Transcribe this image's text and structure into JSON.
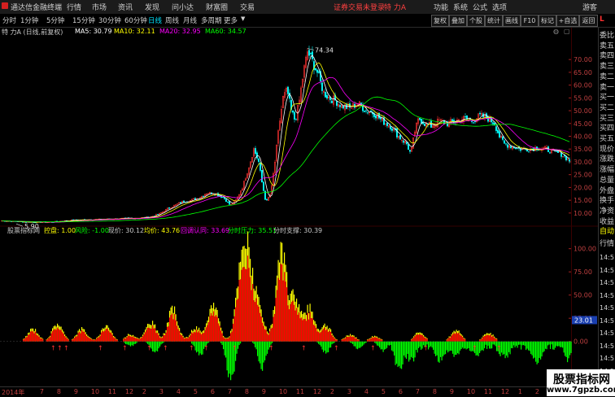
{
  "menu": {
    "app_name": "通达信金融终端",
    "items": [
      "行情",
      "市场",
      "资讯",
      "发现",
      "问小达",
      "财富圈",
      "交易"
    ],
    "notice": "证券交易未登录",
    "stock_name": "特 力A",
    "right_items": [
      "功能",
      "系统",
      "公式",
      "选项",
      "游客"
    ]
  },
  "periods": {
    "items": [
      "分时",
      "1分钟",
      "5分钟",
      "15分钟",
      "30分钟",
      "60分钟",
      "日线",
      "周线",
      "月线",
      "多周期",
      "更多"
    ],
    "active": "日线"
  },
  "toolbar": [
    "复权",
    "叠加",
    "个股",
    "统计",
    "画线",
    "F10",
    "标记",
    "+自选",
    "返回"
  ],
  "main_info": {
    "title": "特 力A (日线,前复权)",
    "ma5": "MA5: 30.79",
    "ma10": "MA10: 32.11",
    "ma20": "MA20: 32.95",
    "ma60": "MA60: 34.57"
  },
  "colors": {
    "rise": "#ff3232",
    "fall": "#00ffff",
    "ma5": "#ffffff",
    "ma10": "#ffff00",
    "ma20": "#ff00ff",
    "ma60": "#00ff00",
    "ind_red": "#ff0000",
    "ind_yellow": "#ffff00",
    "ind_green": "#00ff00"
  },
  "price_labels": {
    "high": "74.34",
    "low": "5.90"
  },
  "chart_data": [
    {
      "type": "candlestick",
      "title": "特 力A (日线,前复权)",
      "y_ticks": [
        70,
        65,
        60,
        55,
        50,
        45,
        40,
        35,
        30,
        25,
        20,
        15,
        10
      ],
      "ylim": [
        5.5,
        78
      ],
      "grid": false,
      "series": [
        {
          "name": "MA5",
          "value": 30.79
        },
        {
          "name": "MA10",
          "value": 32.11
        },
        {
          "name": "MA20",
          "value": 32.95
        },
        {
          "name": "MA60",
          "value": 34.57
        }
      ],
      "close_path": [
        [
          0,
          7
        ],
        [
          30,
          6.5
        ],
        [
          60,
          6.4
        ],
        [
          90,
          7.2
        ],
        [
          120,
          7.5
        ],
        [
          150,
          7.8
        ],
        [
          170,
          8.0
        ],
        [
          185,
          8.5
        ],
        [
          195,
          9.5
        ],
        [
          205,
          11.5
        ],
        [
          215,
          13
        ],
        [
          225,
          14.5
        ],
        [
          235,
          15
        ],
        [
          245,
          16
        ],
        [
          255,
          18
        ],
        [
          265,
          17.5
        ],
        [
          275,
          16
        ],
        [
          283,
          13
        ],
        [
          290,
          15
        ],
        [
          298,
          20
        ],
        [
          305,
          27
        ],
        [
          312,
          35
        ],
        [
          318,
          30
        ],
        [
          322,
          22
        ],
        [
          327,
          14
        ],
        [
          333,
          18
        ],
        [
          338,
          30
        ],
        [
          343,
          44
        ],
        [
          348,
          55
        ],
        [
          353,
          58
        ],
        [
          358,
          50
        ],
        [
          363,
          46
        ],
        [
          368,
          54
        ],
        [
          373,
          65
        ],
        [
          378,
          73
        ],
        [
          383,
          70
        ],
        [
          390,
          65
        ],
        [
          398,
          57
        ],
        [
          405,
          55
        ],
        [
          412,
          54
        ],
        [
          420,
          52
        ],
        [
          430,
          51
        ],
        [
          440,
          53
        ],
        [
          450,
          50
        ],
        [
          460,
          49
        ],
        [
          470,
          46
        ],
        [
          480,
          44
        ],
        [
          490,
          40
        ],
        [
          500,
          37
        ],
        [
          505,
          33
        ],
        [
          510,
          42
        ],
        [
          515,
          47
        ],
        [
          522,
          45
        ],
        [
          530,
          44
        ],
        [
          540,
          46
        ],
        [
          550,
          45
        ],
        [
          560,
          46
        ],
        [
          570,
          47
        ],
        [
          580,
          46
        ],
        [
          590,
          48
        ],
        [
          600,
          47
        ],
        [
          608,
          45
        ],
        [
          614,
          40
        ],
        [
          620,
          37
        ],
        [
          630,
          36
        ],
        [
          640,
          35
        ],
        [
          650,
          35
        ],
        [
          660,
          35.5
        ],
        [
          670,
          35
        ],
        [
          680,
          34
        ],
        [
          690,
          33
        ],
        [
          700,
          30.5
        ]
      ]
    },
    {
      "type": "bar",
      "title": "股票指标网",
      "y_ticks": [
        100,
        75,
        50,
        25,
        0
      ],
      "ylim": [
        -45,
        112
      ],
      "current_value": "23.01"
    }
  ],
  "indicator_info": {
    "name": "股票指标网",
    "kongpan": "控盘: 1.00",
    "fengxian": "风险: -1.00",
    "xianjia": "现价: 30.12",
    "junjia": "均价: 43.76",
    "huitiao": "回调认同: 33.69",
    "yali": "分时压力: 35.51",
    "zhicheng": "分时支撑: 30.39"
  },
  "right_panel": {
    "top": [
      "L",
      "委比",
      "卖五",
      "卖四",
      "卖三",
      "卖二",
      "卖一",
      "买一",
      "买二",
      "买三",
      "买四",
      "买五",
      "现价",
      "涨跌",
      "涨幅",
      "总量",
      "外盘",
      "换手",
      "净资",
      "收益",
      "自动",
      "行情",
      "14:5",
      "14:5",
      "14:5",
      "14:5",
      "14:5",
      "14:5",
      "14:5",
      "14:5",
      "14:5",
      "14:5"
    ]
  },
  "time_axis": [
    "2014年",
    "7",
    "8",
    "9",
    "10",
    "11",
    "12",
    "2",
    "3",
    "4",
    "5",
    "6",
    "7",
    "8",
    "9",
    "10",
    "11",
    "12",
    "2",
    "3",
    "4",
    "5",
    "6",
    "7",
    "8",
    "9",
    "10",
    "11",
    "12",
    "1",
    "2",
    "3",
    "4"
  ],
  "watermark": {
    "line1": "股票指标网",
    "line2": "www.7gpzb.com"
  }
}
